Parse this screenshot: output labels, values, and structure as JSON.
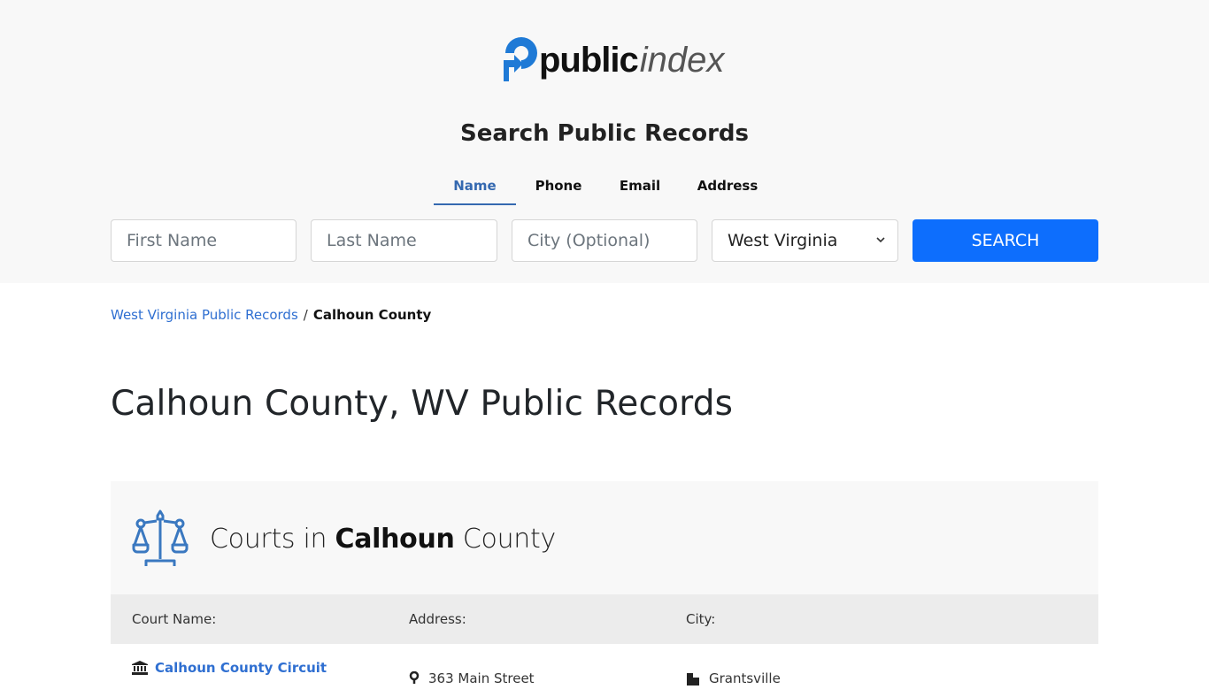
{
  "brand": {
    "name_bold": "public",
    "name_light": "index",
    "accent_color": "#1f7ad6",
    "icon": "arrow-p-logo-icon"
  },
  "search": {
    "title": "Search Public Records",
    "tabs": [
      {
        "label": "Name",
        "active": true
      },
      {
        "label": "Phone",
        "active": false
      },
      {
        "label": "Email",
        "active": false
      },
      {
        "label": "Address",
        "active": false
      }
    ],
    "fields": {
      "first_name_placeholder": "First Name",
      "last_name_placeholder": "Last Name",
      "city_placeholder": "City (Optional)",
      "state_selected": "West Virginia"
    },
    "button_label": "SEARCH",
    "button_color": "#0d6efd"
  },
  "breadcrumb": {
    "parent": "West Virginia Public Records",
    "separator": "/",
    "current": "Calhoun County"
  },
  "page": {
    "title": "Calhoun County, WV Public Records"
  },
  "courts": {
    "title_prefix": "Courts in",
    "title_county": "Calhoun",
    "title_suffix": "County",
    "icon": "scales-of-justice-icon",
    "columns": [
      "Court Name:",
      "Address:",
      "City:"
    ],
    "rows": [
      {
        "name": "Calhoun County Circuit",
        "address": "363 Main Street",
        "city": "Grantsville"
      }
    ]
  }
}
